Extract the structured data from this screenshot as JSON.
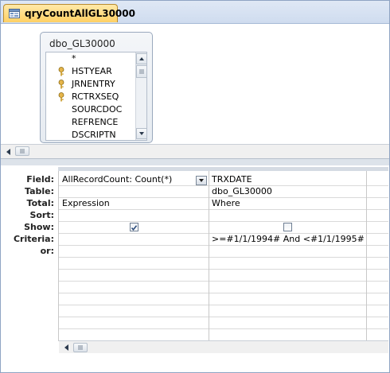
{
  "document_tab": {
    "label": "qryCountAllGL30000",
    "icon": "query-icon"
  },
  "table_box": {
    "title": "dbo_GL30000",
    "fields": [
      {
        "name": "*",
        "key": false
      },
      {
        "name": "HSTYEAR",
        "key": true
      },
      {
        "name": "JRNENTRY",
        "key": true
      },
      {
        "name": "RCTRXSEQ",
        "key": true
      },
      {
        "name": "SOURCDOC",
        "key": false
      },
      {
        "name": "REFRENCE",
        "key": false
      },
      {
        "name": "DSCRIPTN",
        "key": false
      }
    ]
  },
  "grid": {
    "row_labels": {
      "field": "Field:",
      "table": "Table:",
      "total": "Total:",
      "sort": "Sort:",
      "show": "Show:",
      "criteria": "Criteria:",
      "or": "or:"
    },
    "columns": [
      {
        "field": "AllRecordCount: Count(*)",
        "table": "",
        "total": "Expression",
        "sort": "",
        "show": true,
        "criteria": "",
        "or": ""
      },
      {
        "field": "TRXDATE",
        "table": "dbo_GL30000",
        "total": "Where",
        "sort": "",
        "show": false,
        "criteria": ">=#1/1/1994# And <#1/1/1995#",
        "or": ""
      }
    ]
  },
  "colors": {
    "tab_active": "#ffd064",
    "frame": "#8fa4c3",
    "splitter": "#dde3ea"
  }
}
